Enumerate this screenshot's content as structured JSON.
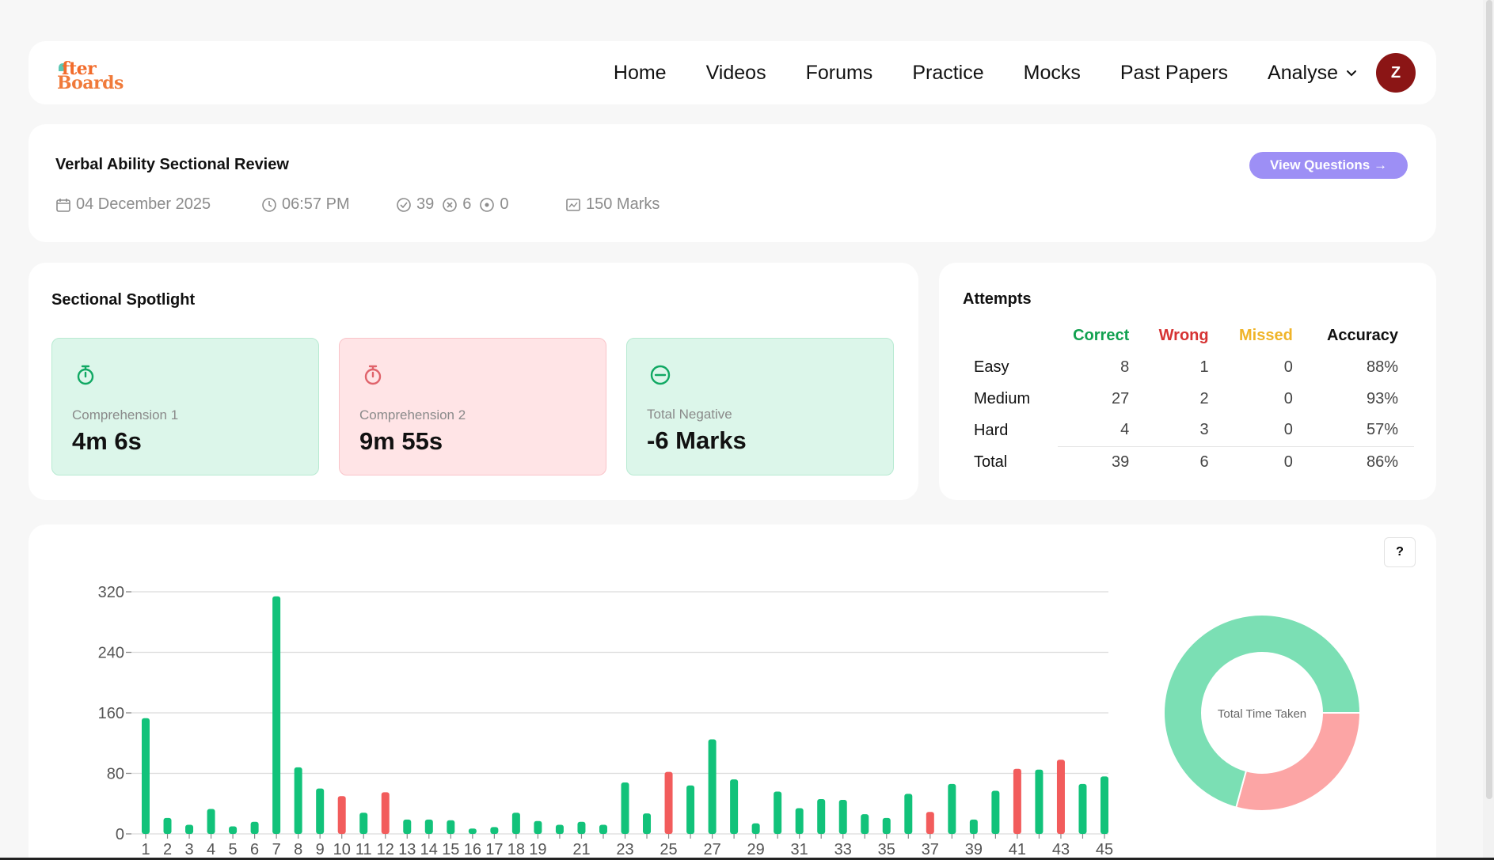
{
  "nav": {
    "logo_line1": "fter",
    "logo_line2": "Boards",
    "items": [
      "Home",
      "Videos",
      "Forums",
      "Practice",
      "Mocks",
      "Past Papers",
      "Analyse"
    ],
    "avatar_initial": "Z"
  },
  "review": {
    "title": "Verbal Ability Sectional Review",
    "view_button": "View Questions →",
    "date": "04 December 2025",
    "time": "06:57 PM",
    "correct": "39",
    "wrong": "6",
    "skipped": "0",
    "marks": "150 Marks",
    "icons": [
      "calendar-icon",
      "clock-icon",
      "check-circle-icon",
      "x-circle-icon",
      "dot-circle-icon",
      "chart-icon"
    ]
  },
  "spotlight": {
    "title": "Sectional Spotlight",
    "tiles": [
      {
        "label": "Comprehension 1",
        "value": "4m 6s",
        "icon": "stopwatch-icon",
        "color": "#10a863"
      },
      {
        "label": "Comprehension 2",
        "value": "9m 55s",
        "icon": "stopwatch-icon",
        "color": "#e0636b"
      },
      {
        "label": "Total Negative",
        "value": "-6 Marks",
        "icon": "minus-circle-icon",
        "color": "#10a863"
      }
    ]
  },
  "attempts": {
    "title": "Attempts",
    "headers": [
      "",
      "Correct",
      "Wrong",
      "Missed",
      "Accuracy"
    ],
    "header_colors": [
      "#111",
      "#12a150",
      "#d63333",
      "#f0b429",
      "#111"
    ],
    "rows": [
      [
        "Easy",
        "8",
        "1",
        "0",
        "88%"
      ],
      [
        "Medium",
        "27",
        "2",
        "0",
        "93%"
      ],
      [
        "Hard",
        "4",
        "3",
        "0",
        "57%"
      ],
      [
        "Total",
        "39",
        "6",
        "0",
        "86%"
      ]
    ]
  },
  "chart": {
    "help_label": "?",
    "donut_label": "Total Time Taken"
  },
  "chart_data": [
    {
      "type": "bar",
      "categories": [
        "1",
        "2",
        "3",
        "4",
        "5",
        "6",
        "7",
        "8",
        "9",
        "10",
        "11",
        "12",
        "13",
        "14",
        "15",
        "16",
        "17",
        "18",
        "19",
        "20",
        "21",
        "22",
        "23",
        "24",
        "25",
        "26",
        "27",
        "28",
        "29",
        "30",
        "31",
        "32",
        "33",
        "34",
        "35",
        "36",
        "37",
        "38",
        "39",
        "40",
        "41",
        "42",
        "43",
        "44",
        "45"
      ],
      "tick_labels": [
        "1",
        "2",
        "3",
        "4",
        "5",
        "6",
        "7",
        "8",
        "9",
        "10",
        "11",
        "12",
        "13",
        "14",
        "15",
        "16",
        "17",
        "18",
        "19",
        "21",
        "23",
        "25",
        "27",
        "29",
        "31",
        "33",
        "35",
        "37",
        "39",
        "41",
        "43",
        "45"
      ],
      "values": [
        153,
        21,
        12,
        33,
        10,
        16,
        314,
        88,
        60,
        50,
        28,
        55,
        19,
        19,
        18,
        7,
        9,
        28,
        17,
        12,
        16,
        12,
        68,
        27,
        82,
        64,
        125,
        72,
        14,
        56,
        34,
        46,
        45,
        26,
        21,
        53,
        29,
        66,
        19,
        57,
        86,
        85,
        98,
        66,
        76
      ],
      "status": [
        "correct",
        "correct",
        "correct",
        "correct",
        "correct",
        "correct",
        "correct",
        "correct",
        "correct",
        "wrong",
        "correct",
        "wrong",
        "correct",
        "correct",
        "correct",
        "correct",
        "correct",
        "correct",
        "correct",
        "correct",
        "correct",
        "correct",
        "correct",
        "correct",
        "wrong",
        "correct",
        "correct",
        "correct",
        "correct",
        "correct",
        "correct",
        "correct",
        "correct",
        "correct",
        "correct",
        "correct",
        "wrong",
        "correct",
        "correct",
        "correct",
        "wrong",
        "correct",
        "wrong",
        "correct",
        "correct"
      ],
      "colors": {
        "correct": "#12c27a",
        "wrong": "#f25c5c"
      },
      "yticks": [
        0,
        80,
        160,
        240,
        320
      ],
      "ylim": [
        0,
        320
      ],
      "grid": true
    },
    {
      "type": "pie",
      "label": "Total Time Taken",
      "values": [
        246,
        595
      ],
      "colors": [
        "#fca5a5",
        "#7bdfb4"
      ]
    }
  ]
}
